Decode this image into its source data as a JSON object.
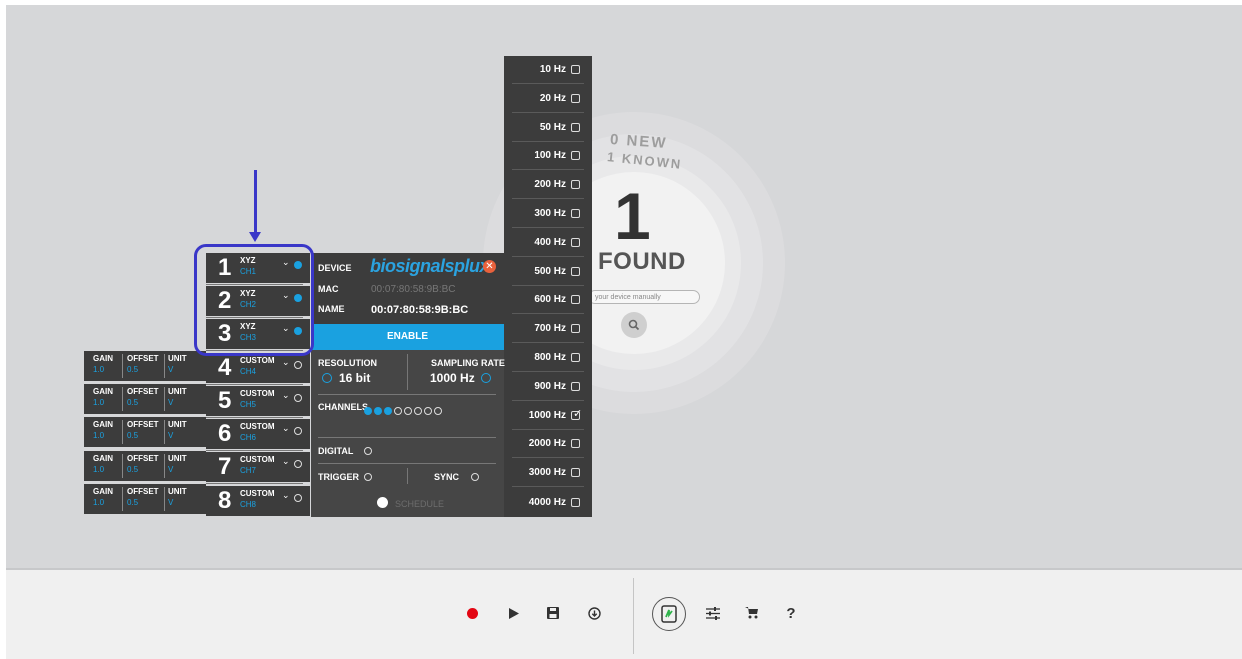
{
  "discovery": {
    "new_label": "0 NEW",
    "known_label": "1 KNOWN",
    "found_count": "1",
    "found_label": "FOUND",
    "manual_placeholder": "your device manually",
    "search_icon": "search-icon"
  },
  "sampling_rates": [
    {
      "label": "10 Hz",
      "checked": false
    },
    {
      "label": "20 Hz",
      "checked": false
    },
    {
      "label": "50 Hz",
      "checked": false
    },
    {
      "label": "100 Hz",
      "checked": false
    },
    {
      "label": "200 Hz",
      "checked": false
    },
    {
      "label": "300 Hz",
      "checked": false
    },
    {
      "label": "400 Hz",
      "checked": false
    },
    {
      "label": "500 Hz",
      "checked": false
    },
    {
      "label": "600 Hz",
      "checked": false
    },
    {
      "label": "700 Hz",
      "checked": false
    },
    {
      "label": "800 Hz",
      "checked": false
    },
    {
      "label": "900 Hz",
      "checked": false
    },
    {
      "label": "1000 Hz",
      "checked": true
    },
    {
      "label": "2000 Hz",
      "checked": false
    },
    {
      "label": "3000 Hz",
      "checked": false
    },
    {
      "label": "4000 Hz",
      "checked": false
    }
  ],
  "device": {
    "device_label": "DEVICE",
    "device_name": "biosignalsplux",
    "mac_label": "MAC",
    "mac_value": "00:07:80:58:9B:BC",
    "name_label": "NAME",
    "name_value": "00:07:80:58:9B:BC",
    "enable_label": "ENABLE",
    "resolution_label": "RESOLUTION",
    "resolution_value": "16 bit",
    "sampling_label": "SAMPLING RATE",
    "sampling_value": "1000 Hz",
    "channels_label": "CHANNELS",
    "channels_active": [
      true,
      true,
      true,
      false,
      false,
      false,
      false,
      false
    ],
    "digital_label": "DIGITAL",
    "trigger_label": "TRIGGER",
    "sync_label": "SYNC",
    "schedule_label": "SCHEDULE"
  },
  "channels": [
    {
      "num": "1",
      "type": "XYZ",
      "id": "CH1",
      "active": true
    },
    {
      "num": "2",
      "type": "XYZ",
      "id": "CH2",
      "active": true
    },
    {
      "num": "3",
      "type": "XYZ",
      "id": "CH3",
      "active": true
    },
    {
      "num": "4",
      "type": "CUSTOM",
      "id": "CH4",
      "active": false
    },
    {
      "num": "5",
      "type": "CUSTOM",
      "id": "CH5",
      "active": false
    },
    {
      "num": "6",
      "type": "CUSTOM",
      "id": "CH6",
      "active": false
    },
    {
      "num": "7",
      "type": "CUSTOM",
      "id": "CH7",
      "active": false
    },
    {
      "num": "8",
      "type": "CUSTOM",
      "id": "CH8",
      "active": false
    }
  ],
  "gain_header": {
    "gain": "GAIN",
    "offset": "OFFSET",
    "unit": "UNIT"
  },
  "gain_rows": [
    {
      "gain": "1.0",
      "offset": "0.5",
      "unit": "V"
    },
    {
      "gain": "1.0",
      "offset": "0.5",
      "unit": "V"
    },
    {
      "gain": "1.0",
      "offset": "0.5",
      "unit": "V"
    },
    {
      "gain": "1.0",
      "offset": "0.5",
      "unit": "V"
    },
    {
      "gain": "1.0",
      "offset": "0.5",
      "unit": "V"
    }
  ],
  "toolbar": {
    "icons": [
      "record-icon",
      "play-icon",
      "save-icon",
      "download-icon",
      "plux-device-icon",
      "settings-sliders-icon",
      "cart-icon",
      "help-icon"
    ],
    "help_label": "?"
  },
  "colors": {
    "accent": "#1aa1e0",
    "record": "#e30613",
    "annotation": "#3a37c8",
    "close": "#e8613c"
  }
}
